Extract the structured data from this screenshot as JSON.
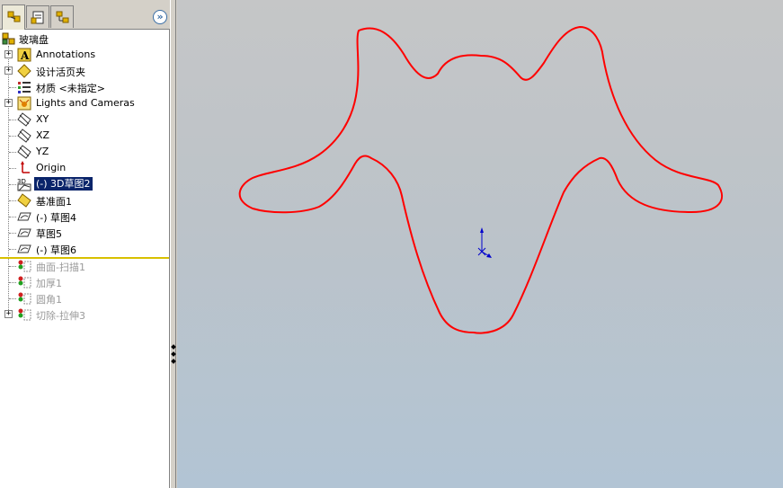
{
  "feature_tree": {
    "root_label": "玻璃盘",
    "items": [
      {
        "label": "Annotations",
        "icon": "annotations-icon"
      },
      {
        "label": "设计活页夹",
        "icon": "design-binder-icon"
      },
      {
        "label": "材质 <未指定>",
        "icon": "material-icon"
      },
      {
        "label": "Lights and Cameras",
        "icon": "lights-cameras-icon"
      },
      {
        "label": "XY",
        "icon": "plane-icon"
      },
      {
        "label": "XZ",
        "icon": "plane-icon"
      },
      {
        "label": "YZ",
        "icon": "plane-icon"
      },
      {
        "label": "Origin",
        "icon": "origin-icon"
      },
      {
        "label": "(-) 3D草图2",
        "icon": "3d-sketch-icon",
        "selected": true
      },
      {
        "label": "基准面1",
        "icon": "ref-plane-icon"
      },
      {
        "label": "(-) 草图4",
        "icon": "sketch-icon"
      },
      {
        "label": "草图5",
        "icon": "sketch-icon"
      },
      {
        "label": "(-) 草图6",
        "icon": "sketch-icon"
      },
      {
        "label": "曲面-扫描1",
        "icon": "surface-sweep-icon",
        "suppressed": true
      },
      {
        "label": "加厚1",
        "icon": "thicken-icon",
        "suppressed": true
      },
      {
        "label": "圆角1",
        "icon": "fillet-icon",
        "suppressed": true
      },
      {
        "label": "切除-拉伸3",
        "icon": "cut-extrude-icon",
        "suppressed": true
      }
    ]
  },
  "tabs": [
    {
      "name": "feature-manager-tab-icon"
    },
    {
      "name": "property-manager-tab-icon"
    },
    {
      "name": "configuration-manager-tab-icon"
    }
  ],
  "expand_button": "»",
  "colors": {
    "sketch_curve": "#ff0000",
    "selection_bg": "#0a246a",
    "rollback_bar": "#d8c000",
    "triad": "#0000cc"
  }
}
